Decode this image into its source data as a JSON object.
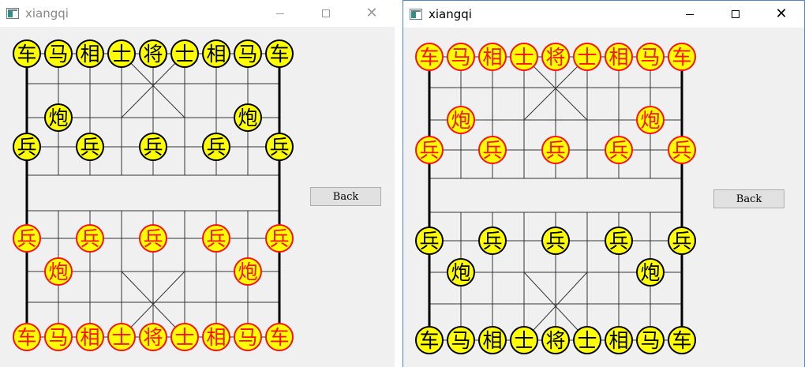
{
  "windows": [
    {
      "title": "xiangqi",
      "active": false,
      "back_label": "Back",
      "top_color": "black",
      "bottom_color": "red"
    },
    {
      "title": "xiangqi",
      "active": true,
      "back_label": "Back",
      "top_color": "red",
      "bottom_color": "black"
    }
  ],
  "pieces": {
    "back_row": [
      "车",
      "马",
      "相",
      "士",
      "将",
      "士",
      "相",
      "马",
      "车"
    ],
    "cannon": "炮",
    "soldier": "兵"
  },
  "colors": {
    "piece_fill": "#ffff00",
    "red_piece": "#ff1010",
    "black_piece": "#000000",
    "board_background": "#f0f0f0",
    "active_window_border": "#4f86c6"
  }
}
